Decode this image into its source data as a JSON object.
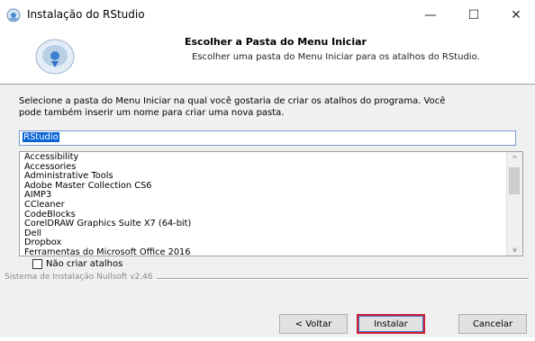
{
  "window": {
    "title": "Instalação do RStudio",
    "controls": {
      "minimize": "—",
      "maximize": "☐",
      "close": "✕"
    }
  },
  "header": {
    "title": "Escolher a Pasta do Menu Iniciar",
    "subtitle": "Escolher uma pasta do Menu Iniciar para os atalhos do RStudio."
  },
  "instruction": {
    "line1": "Selecione a pasta do Menu Iniciar na qual você gostaria de criar os atalhos do programa. Você",
    "line2": "pode também inserir um nome para criar uma nova pasta."
  },
  "folder_input": {
    "value": "RStudio"
  },
  "folder_list": {
    "items": [
      "Accessibility",
      "Accessories",
      "Administrative Tools",
      "Adobe Master Collection CS6",
      "AIMP3",
      "CCleaner",
      "CodeBlocks",
      "CorelDRAW Graphics Suite X7 (64-bit)",
      "Dell",
      "Dropbox",
      "Ferramentas do Microsoft Office 2016"
    ],
    "scroll_up": "^",
    "scroll_down": "v"
  },
  "no_shortcuts_checkbox": {
    "label": "Não criar atalhos",
    "checked": false
  },
  "footer": {
    "nsis_label": "Sistema de Instalação Nullsoft v2.46"
  },
  "buttons": {
    "back": "< Voltar",
    "install": "Instalar",
    "cancel": "Cancelar"
  },
  "icons": {
    "app": "installer-app-icon",
    "header": "installer-disc-icon"
  },
  "colors": {
    "selection": "#0a64d6",
    "highlight_border": "#d11b2d"
  }
}
